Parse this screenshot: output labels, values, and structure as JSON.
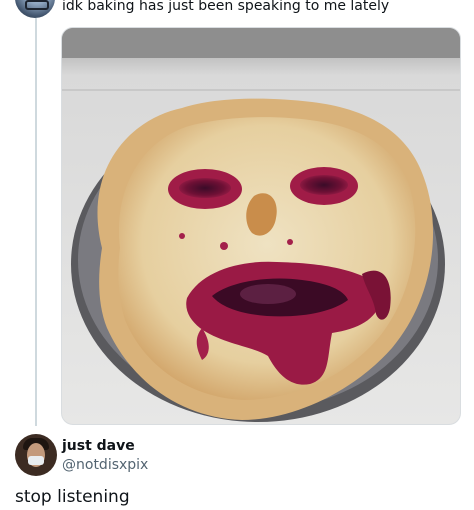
{
  "top_tweet": {
    "text": "idk baking has just been speaking to me lately"
  },
  "photo": {
    "icon": "pie-face-photo"
  },
  "reply": {
    "name": "just dave",
    "handle": "@notdisxpix",
    "text": "stop listening"
  }
}
